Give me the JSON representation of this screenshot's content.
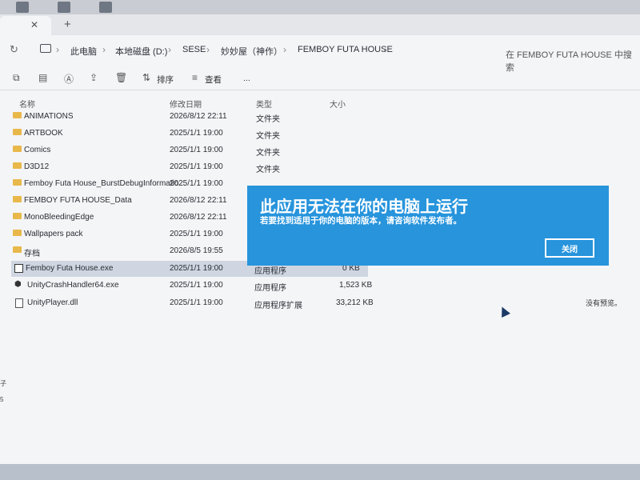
{
  "breadcrumb": [
    "此电脑",
    "本地磁盘 (D:)",
    "SESE",
    "妙妙屋（神作）",
    "FEMBOY FUTA HOUSE"
  ],
  "search_placeholder": "在 FEMBOY FUTA HOUSE 中搜索",
  "toolbar": {
    "sort_label": "排序",
    "view_label": "查看",
    "more_label": "..."
  },
  "columns": {
    "name": "名称",
    "date": "修改日期",
    "type": "类型",
    "size": "大小"
  },
  "files": [
    {
      "name": "ANIMATIONS",
      "date": "2026/8/12 22:11",
      "type": "文件夹",
      "size": "",
      "icon": "folder-icon"
    },
    {
      "name": "ARTBOOK",
      "date": "2025/1/1 19:00",
      "type": "文件夹",
      "size": "",
      "icon": "folder-icon"
    },
    {
      "name": "Comics",
      "date": "2025/1/1 19:00",
      "type": "文件夹",
      "size": "",
      "icon": "folder-icon"
    },
    {
      "name": "D3D12",
      "date": "2025/1/1 19:00",
      "type": "文件夹",
      "size": "",
      "icon": "folder-icon"
    },
    {
      "name": "Femboy Futa House_BurstDebugInformatio...",
      "date": "2025/1/1 19:00",
      "type": "",
      "size": "",
      "icon": "folder-icon"
    },
    {
      "name": "FEMBOY FUTA HOUSE_Data",
      "date": "2026/8/12 22:11",
      "type": "",
      "size": "",
      "icon": "folder-icon"
    },
    {
      "name": "MonoBleedingEdge",
      "date": "2026/8/12 22:11",
      "type": "",
      "size": "",
      "icon": "folder-icon"
    },
    {
      "name": "Wallpapers pack",
      "date": "2025/1/1 19:00",
      "type": "",
      "size": "",
      "icon": "folder-icon"
    },
    {
      "name": "存档",
      "date": "2026/8/5 19:55",
      "type": "",
      "size": "",
      "icon": "folder-icon"
    },
    {
      "name": "Femboy Futa House.exe",
      "date": "2025/1/1 19:00",
      "type": "应用程序",
      "size": "0 KB",
      "icon": "exe-icon"
    },
    {
      "name": "UnityCrashHandler64.exe",
      "date": "2025/1/1 19:00",
      "type": "应用程序",
      "size": "1,523 KB",
      "icon": "unity-icon"
    },
    {
      "name": "UnityPlayer.dll",
      "date": "2025/1/1 19:00",
      "type": "应用程序扩展",
      "size": "33,212 KB",
      "icon": "dll-icon"
    }
  ],
  "preview_text": "没有预览。",
  "dialog": {
    "title": "此应用无法在你的电脑上运行",
    "message": "若要找到适用于你的电脑的版本，请咨询软件发布者。",
    "close_label": "关闭",
    "background": "#2794dc"
  },
  "left_labels": [
    "子",
    "5"
  ]
}
